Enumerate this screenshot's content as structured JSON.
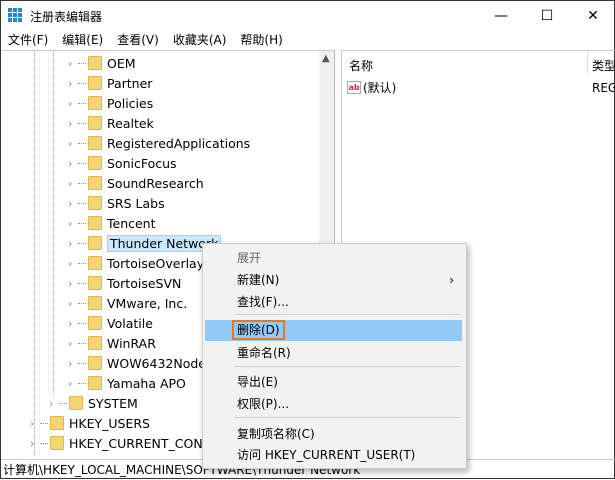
{
  "window": {
    "title": "注册表编辑器",
    "minimize": "—",
    "maximize": "☐",
    "close": "✕"
  },
  "menubar": [
    "文件(F)",
    "编辑(E)",
    "查看(V)",
    "收藏夹(A)",
    "帮助(H)"
  ],
  "tree": {
    "software_children": [
      "OEM",
      "Partner",
      "Policies",
      "Realtek",
      "RegisteredApplications",
      "SonicFocus",
      "SoundResearch",
      "SRS Labs",
      "Tencent",
      "Thunder Network",
      "TortoiseOverlays",
      "TortoiseSVN",
      "VMware, Inc.",
      "Volatile",
      "WinRAR",
      "WOW6432Node",
      "Yamaha APO"
    ],
    "selected": "Thunder Network",
    "system": "SYSTEM",
    "roots": [
      "HKEY_USERS",
      "HKEY_CURRENT_CONFIG"
    ]
  },
  "values_pane": {
    "col_name": "名称",
    "col_type": "类型",
    "rows": [
      {
        "name": "(默认)",
        "type": "REG"
      }
    ]
  },
  "context_menu": {
    "items": [
      {
        "label": "展开",
        "disabled": true
      },
      {
        "label": "新建(N)",
        "submenu": true
      },
      {
        "label": "查找(F)..."
      },
      {
        "label": "删除(D)",
        "highlighted": true
      },
      {
        "label": "重命名(R)"
      },
      {
        "label": "导出(E)"
      },
      {
        "label": "权限(P)..."
      },
      {
        "label": "复制项名称(C)"
      },
      {
        "label": "访问 HKEY_CURRENT_USER(T)"
      }
    ]
  },
  "statusbar": "计算机\\HKEY_LOCAL_MACHINE\\SOFTWARE\\Thunder Network"
}
